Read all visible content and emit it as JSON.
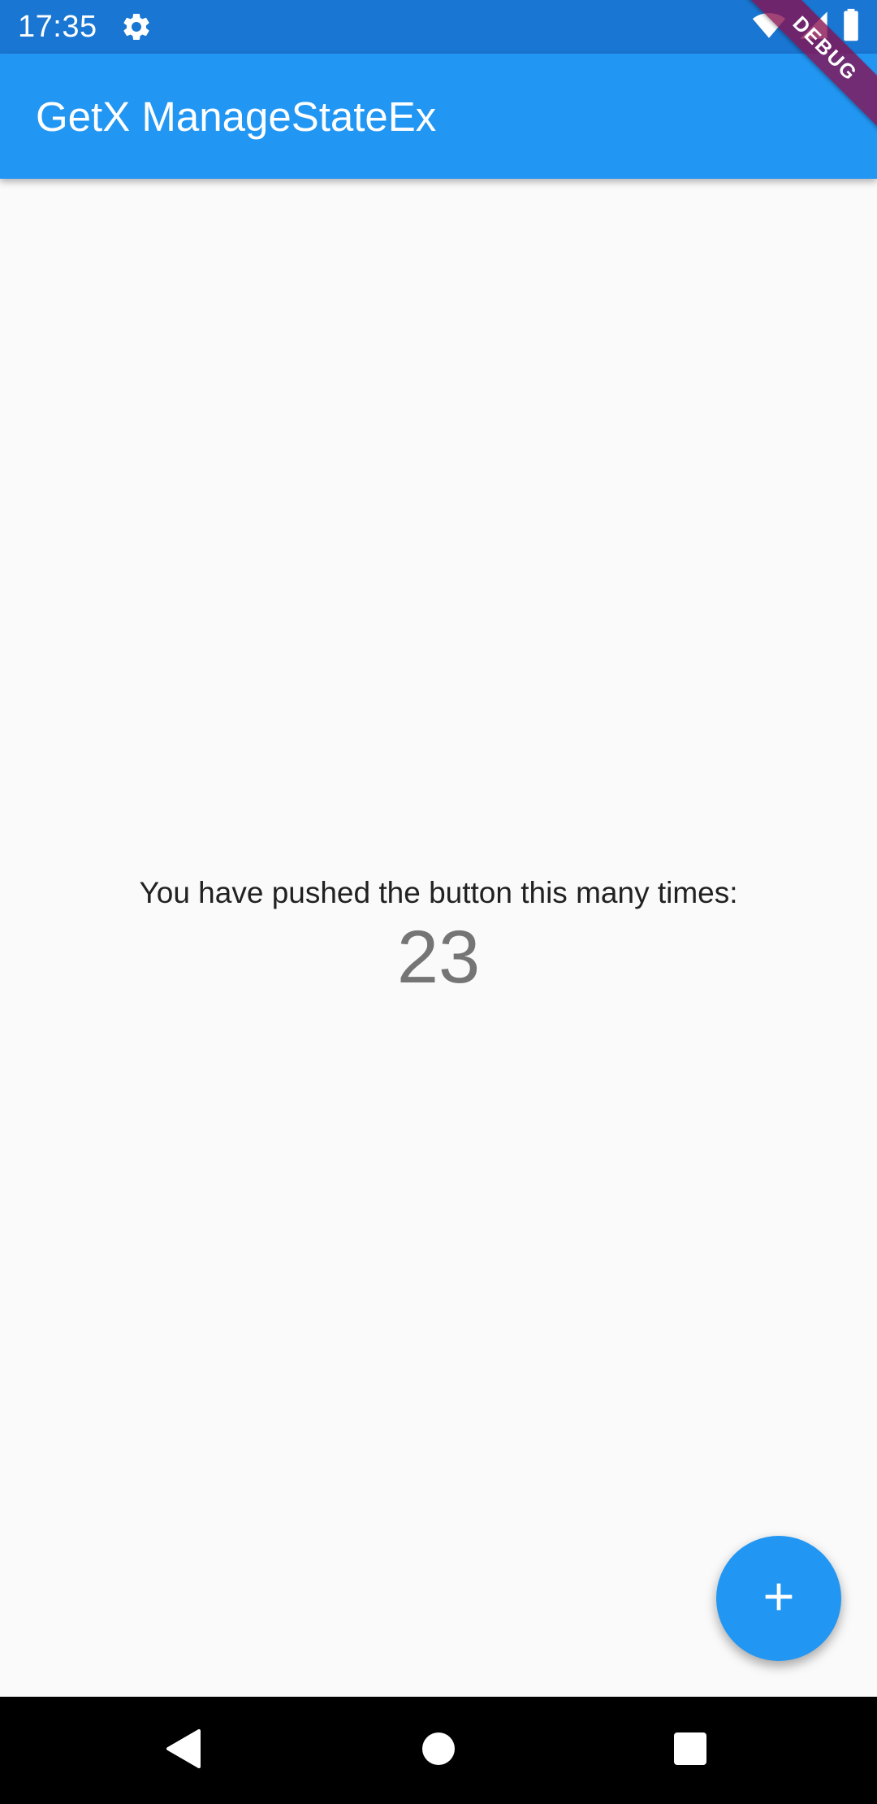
{
  "status_bar": {
    "time": "17:35",
    "icons": [
      "settings-icon",
      "wifi-icon",
      "signal-icon",
      "battery-icon"
    ]
  },
  "app_bar": {
    "title": "GetX ManageStateEx"
  },
  "debug_banner": {
    "label": "DEBUG"
  },
  "body": {
    "caption": "You have pushed the button this many times:",
    "counter": "23"
  },
  "fab": {
    "icon": "add-icon"
  },
  "nav_bar": {
    "buttons": [
      "back-icon",
      "home-icon",
      "recents-icon"
    ]
  },
  "colors": {
    "status_bar": "#1976d2",
    "primary": "#2196f3",
    "background": "#fafafa",
    "debug_banner": "#880e4f"
  }
}
